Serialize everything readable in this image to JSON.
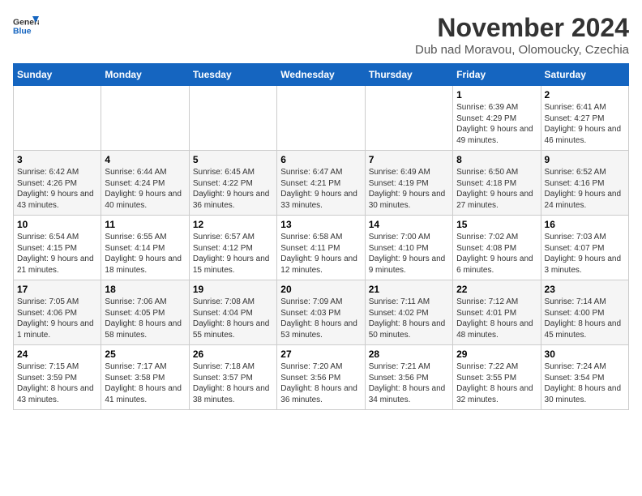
{
  "header": {
    "logo_line1": "General",
    "logo_line2": "Blue",
    "month_title": "November 2024",
    "location": "Dub nad Moravou, Olomoucky, Czechia"
  },
  "weekdays": [
    "Sunday",
    "Monday",
    "Tuesday",
    "Wednesday",
    "Thursday",
    "Friday",
    "Saturday"
  ],
  "weeks": [
    [
      {
        "day": "",
        "info": ""
      },
      {
        "day": "",
        "info": ""
      },
      {
        "day": "",
        "info": ""
      },
      {
        "day": "",
        "info": ""
      },
      {
        "day": "",
        "info": ""
      },
      {
        "day": "1",
        "info": "Sunrise: 6:39 AM\nSunset: 4:29 PM\nDaylight: 9 hours\nand 49 minutes."
      },
      {
        "day": "2",
        "info": "Sunrise: 6:41 AM\nSunset: 4:27 PM\nDaylight: 9 hours\nand 46 minutes."
      }
    ],
    [
      {
        "day": "3",
        "info": "Sunrise: 6:42 AM\nSunset: 4:26 PM\nDaylight: 9 hours\nand 43 minutes."
      },
      {
        "day": "4",
        "info": "Sunrise: 6:44 AM\nSunset: 4:24 PM\nDaylight: 9 hours\nand 40 minutes."
      },
      {
        "day": "5",
        "info": "Sunrise: 6:45 AM\nSunset: 4:22 PM\nDaylight: 9 hours\nand 36 minutes."
      },
      {
        "day": "6",
        "info": "Sunrise: 6:47 AM\nSunset: 4:21 PM\nDaylight: 9 hours\nand 33 minutes."
      },
      {
        "day": "7",
        "info": "Sunrise: 6:49 AM\nSunset: 4:19 PM\nDaylight: 9 hours\nand 30 minutes."
      },
      {
        "day": "8",
        "info": "Sunrise: 6:50 AM\nSunset: 4:18 PM\nDaylight: 9 hours\nand 27 minutes."
      },
      {
        "day": "9",
        "info": "Sunrise: 6:52 AM\nSunset: 4:16 PM\nDaylight: 9 hours\nand 24 minutes."
      }
    ],
    [
      {
        "day": "10",
        "info": "Sunrise: 6:54 AM\nSunset: 4:15 PM\nDaylight: 9 hours\nand 21 minutes."
      },
      {
        "day": "11",
        "info": "Sunrise: 6:55 AM\nSunset: 4:14 PM\nDaylight: 9 hours\nand 18 minutes."
      },
      {
        "day": "12",
        "info": "Sunrise: 6:57 AM\nSunset: 4:12 PM\nDaylight: 9 hours\nand 15 minutes."
      },
      {
        "day": "13",
        "info": "Sunrise: 6:58 AM\nSunset: 4:11 PM\nDaylight: 9 hours\nand 12 minutes."
      },
      {
        "day": "14",
        "info": "Sunrise: 7:00 AM\nSunset: 4:10 PM\nDaylight: 9 hours\nand 9 minutes."
      },
      {
        "day": "15",
        "info": "Sunrise: 7:02 AM\nSunset: 4:08 PM\nDaylight: 9 hours\nand 6 minutes."
      },
      {
        "day": "16",
        "info": "Sunrise: 7:03 AM\nSunset: 4:07 PM\nDaylight: 9 hours\nand 3 minutes."
      }
    ],
    [
      {
        "day": "17",
        "info": "Sunrise: 7:05 AM\nSunset: 4:06 PM\nDaylight: 9 hours\nand 1 minute."
      },
      {
        "day": "18",
        "info": "Sunrise: 7:06 AM\nSunset: 4:05 PM\nDaylight: 8 hours\nand 58 minutes."
      },
      {
        "day": "19",
        "info": "Sunrise: 7:08 AM\nSunset: 4:04 PM\nDaylight: 8 hours\nand 55 minutes."
      },
      {
        "day": "20",
        "info": "Sunrise: 7:09 AM\nSunset: 4:03 PM\nDaylight: 8 hours\nand 53 minutes."
      },
      {
        "day": "21",
        "info": "Sunrise: 7:11 AM\nSunset: 4:02 PM\nDaylight: 8 hours\nand 50 minutes."
      },
      {
        "day": "22",
        "info": "Sunrise: 7:12 AM\nSunset: 4:01 PM\nDaylight: 8 hours\nand 48 minutes."
      },
      {
        "day": "23",
        "info": "Sunrise: 7:14 AM\nSunset: 4:00 PM\nDaylight: 8 hours\nand 45 minutes."
      }
    ],
    [
      {
        "day": "24",
        "info": "Sunrise: 7:15 AM\nSunset: 3:59 PM\nDaylight: 8 hours\nand 43 minutes."
      },
      {
        "day": "25",
        "info": "Sunrise: 7:17 AM\nSunset: 3:58 PM\nDaylight: 8 hours\nand 41 minutes."
      },
      {
        "day": "26",
        "info": "Sunrise: 7:18 AM\nSunset: 3:57 PM\nDaylight: 8 hours\nand 38 minutes."
      },
      {
        "day": "27",
        "info": "Sunrise: 7:20 AM\nSunset: 3:56 PM\nDaylight: 8 hours\nand 36 minutes."
      },
      {
        "day": "28",
        "info": "Sunrise: 7:21 AM\nSunset: 3:56 PM\nDaylight: 8 hours\nand 34 minutes."
      },
      {
        "day": "29",
        "info": "Sunrise: 7:22 AM\nSunset: 3:55 PM\nDaylight: 8 hours\nand 32 minutes."
      },
      {
        "day": "30",
        "info": "Sunrise: 7:24 AM\nSunset: 3:54 PM\nDaylight: 8 hours\nand 30 minutes."
      }
    ]
  ]
}
